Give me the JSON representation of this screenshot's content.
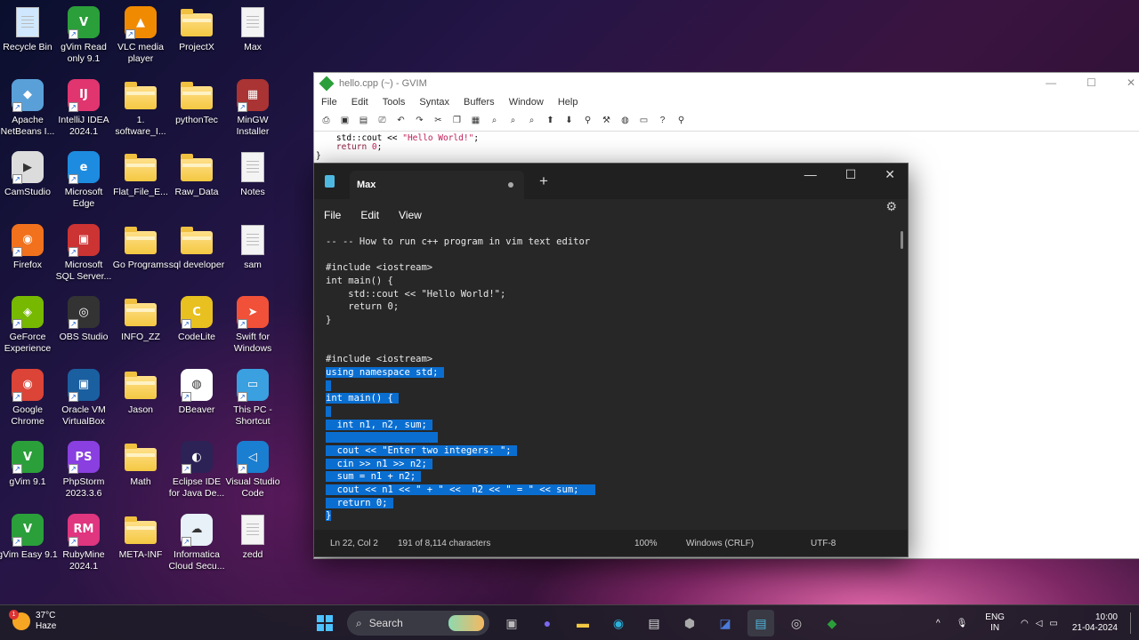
{
  "desktop": {
    "icons": [
      {
        "label": "Recycle Bin"
      },
      {
        "label": "gVim Read\nonly 9.1"
      },
      {
        "label": "VLC media\nplayer"
      },
      {
        "label": "ProjectX"
      },
      {
        "label": "Max"
      },
      {
        "label": "Apache\nNetBeans I..."
      },
      {
        "label": "IntelliJ IDEA\n2024.1"
      },
      {
        "label": "1.\nsoftware_I..."
      },
      {
        "label": "pythonTec"
      },
      {
        "label": "MinGW\nInstaller"
      },
      {
        "label": "CamStudio"
      },
      {
        "label": "Microsoft\nEdge"
      },
      {
        "label": "Flat_File_E..."
      },
      {
        "label": "Raw_Data"
      },
      {
        "label": "Notes"
      },
      {
        "label": "Firefox"
      },
      {
        "label": "Microsoft\nSQL Server..."
      },
      {
        "label": "Go Programs"
      },
      {
        "label": "sql developer"
      },
      {
        "label": "sam"
      },
      {
        "label": "GeForce\nExperience"
      },
      {
        "label": "OBS Studio"
      },
      {
        "label": "INFO_ZZ"
      },
      {
        "label": "CodeLite"
      },
      {
        "label": "Swift for\nWindows"
      },
      {
        "label": "Google\nChrome"
      },
      {
        "label": "Oracle VM\nVirtualBox"
      },
      {
        "label": "Jason"
      },
      {
        "label": "DBeaver"
      },
      {
        "label": "This PC -\nShortcut"
      },
      {
        "label": "gVim 9.1"
      },
      {
        "label": "PhpStorm\n2023.3.6"
      },
      {
        "label": "Math"
      },
      {
        "label": "Eclipse IDE\nfor Java De..."
      },
      {
        "label": "Visual Studio\nCode"
      },
      {
        "label": "gVim Easy 9.1"
      },
      {
        "label": "RubyMine\n2024.1"
      },
      {
        "label": "META-INF"
      },
      {
        "label": "Informatica\nCloud Secu..."
      },
      {
        "label": "zedd"
      }
    ]
  },
  "gvim": {
    "title": "hello.cpp (~) - GVIM",
    "menu": [
      "File",
      "Edit",
      "Tools",
      "Syntax",
      "Buffers",
      "Window",
      "Help"
    ],
    "code": {
      "l1_pre": "    std::cout << ",
      "l1_str": "\"Hello World!\"",
      "l1_post": ";",
      "l2_kw": "    return",
      "l2_num": " 0",
      "l2_post": ";",
      "l3": "}"
    }
  },
  "notepad": {
    "tab_title": "Max",
    "menu": [
      "File",
      "Edit",
      "View"
    ],
    "lines": [
      {
        "text": "-- -- How to run c++ program in vim text editor",
        "sel": ""
      },
      {
        "text": "",
        "sel": ""
      },
      {
        "text": "#include <iostream>",
        "sel": ""
      },
      {
        "text": "int main() {",
        "sel": ""
      },
      {
        "text": "    std::cout << \"Hello World!\";",
        "sel": ""
      },
      {
        "text": "    return 0;",
        "sel": ""
      },
      {
        "text": "}",
        "sel": ""
      },
      {
        "text": "",
        "sel": ""
      },
      {
        "text": "",
        "sel": ""
      },
      {
        "text": "#include <iostream>",
        "sel": ""
      },
      {
        "text": "",
        "sel": "using namespace std; "
      },
      {
        "text": "",
        "sel": " "
      },
      {
        "text": "",
        "sel": "int main() { "
      },
      {
        "text": "",
        "sel": " "
      },
      {
        "text": "",
        "sel": "  int n1, n2, sum; "
      },
      {
        "text": "",
        "sel": "                    "
      },
      {
        "text": "",
        "sel": "  cout << \"Enter two integers: \"; "
      },
      {
        "text": "",
        "sel": "  cin >> n1 >> n2; "
      },
      {
        "text": "",
        "sel": "  sum = n1 + n2; "
      },
      {
        "text": "",
        "sel": "  cout << n1 << \" + \" <<  n2 << \" = \" << sum;   "
      },
      {
        "text": "",
        "sel": "  return 0; "
      },
      {
        "text": "",
        "sel": "}"
      }
    ],
    "status": {
      "position": "Ln 22, Col 2",
      "chars": "191 of 8,114 characters",
      "zoom": "100%",
      "line_endings": "Windows (CRLF)",
      "encoding": "UTF-8"
    }
  },
  "taskbar": {
    "weather_temp": "37°C",
    "weather_desc": "Haze",
    "weather_badge": "1",
    "search_placeholder": "Search",
    "lang_top": "ENG",
    "lang_bottom": "IN",
    "time": "10:00",
    "date": "21-04-2024"
  }
}
